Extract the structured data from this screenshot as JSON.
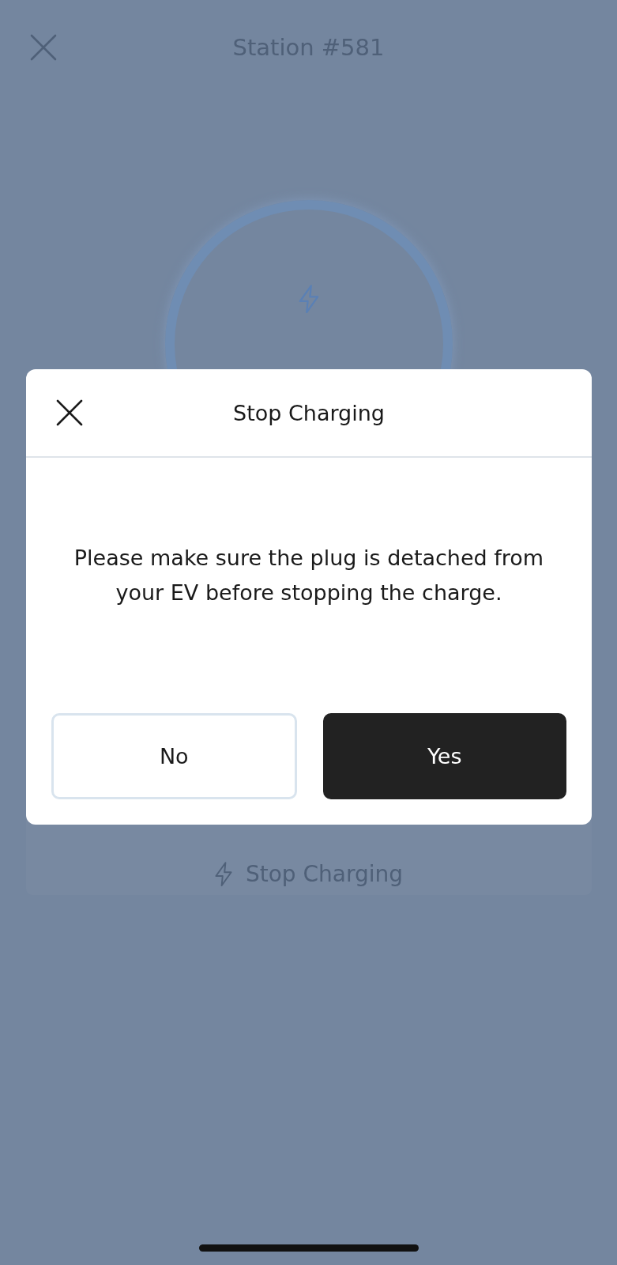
{
  "header": {
    "title": "Station #581"
  },
  "stop_button": {
    "label": "Stop Charging"
  },
  "dialog": {
    "title": "Stop Charging",
    "message": "Please make sure the plug is detached from your EV before stopping the charge.",
    "buttons": [
      {
        "label": "No",
        "kind": "secondary"
      },
      {
        "label": "Yes",
        "kind": "primary"
      }
    ]
  }
}
